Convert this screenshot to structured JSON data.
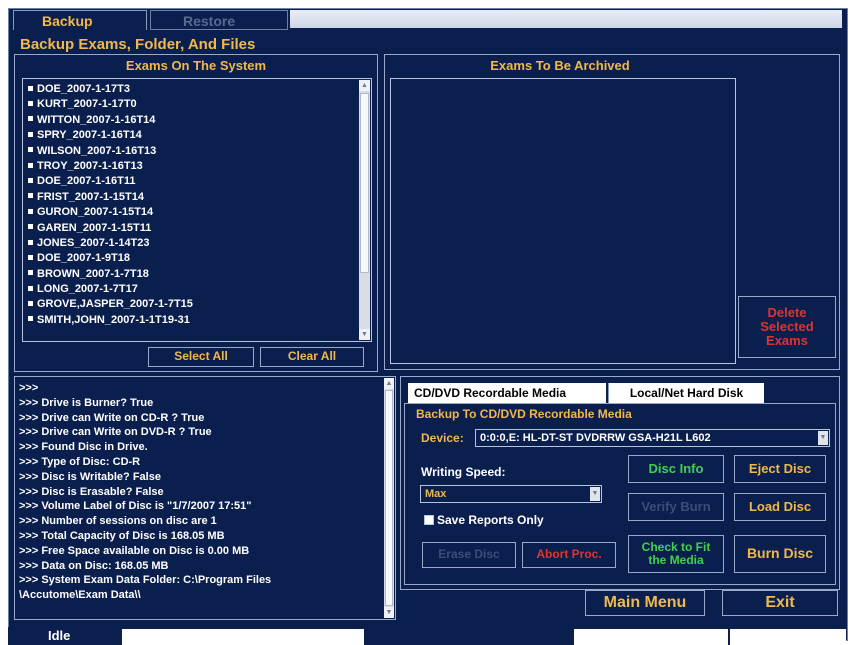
{
  "tabs": {
    "backup": "Backup",
    "restore": "Restore"
  },
  "page_title": "Backup Exams, Folder, And Files",
  "exams_on_system": {
    "header": "Exams On The System",
    "items": [
      "DOE_2007-1-17T3",
      "KURT_2007-1-17T0",
      "WITTON_2007-1-16T14",
      "SPRY_2007-1-16T14",
      "WILSON_2007-1-16T13",
      "TROY_2007-1-16T13",
      "DOE_2007-1-16T11",
      "FRIST_2007-1-15T14",
      "GURON_2007-1-15T14",
      "GAREN_2007-1-15T11",
      "JONES_2007-1-14T23",
      "DOE_2007-1-9T18",
      "BROWN_2007-1-7T18",
      "LONG_2007-1-7T17",
      "GROVE,JASPER_2007-1-7T15",
      "SMITH,JOHN_2007-1-1T19-31"
    ],
    "select_all": "Select All",
    "clear_all": "Clear All"
  },
  "exams_to_archive": {
    "header": "Exams To Be Archived",
    "delete_selected": "Delete Selected Exams"
  },
  "log": [
    ">>>",
    ">>> Drive is Burner? True",
    ">>> Drive can Write on CD-R ? True",
    ">>> Drive can Write on DVD-R ? True",
    ">>> Found Disc in Drive.",
    ">>> Type of Disc: CD-R",
    ">>> Disc is Writable? False",
    ">>> Disc is Erasable? False",
    ">>> Volume Label of Disc is \"1/7/2007 17:51\"",
    ">>> Number of sessions on disc are 1",
    ">>> Total Capacity of Disc is 168.05 MB",
    ">>> Free Space available on Disc is 0.00 MB",
    ">>> Data on Disc: 168.05 MB",
    ">>> System Exam Data Folder: C:\\Program Files",
    "\\Accutome\\Exam Data\\\\"
  ],
  "media": {
    "tab_cd": "CD/DVD  Recordable Media",
    "tab_hd": "Local/Net Hard Disk",
    "section_title": "Backup To CD/DVD Recordable Media",
    "device_label": "Device:",
    "device_value": "0:0:0,E: HL-DT-ST DVDRRW GSA-H21L  L602",
    "speed_label": "Writing Speed:",
    "speed_value": "Max",
    "save_reports_only": "Save Reports Only",
    "disc_info": "Disc Info",
    "eject_disc": "Eject Disc",
    "verify_burn": "Verify Burn",
    "load_disc": "Load Disc",
    "erase_disc": "Erase Disc",
    "abort_proc": "Abort Proc.",
    "check_fit": "Check to Fit the Media",
    "burn_disc": "Burn Disc"
  },
  "footer": {
    "main_menu": "Main Menu",
    "exit": "Exit"
  },
  "status": {
    "text": "Idle"
  },
  "colors": {
    "background": "#0b1f4f",
    "accent": "#f1b84a",
    "green": "#3fd34a",
    "red": "#e0332e"
  }
}
